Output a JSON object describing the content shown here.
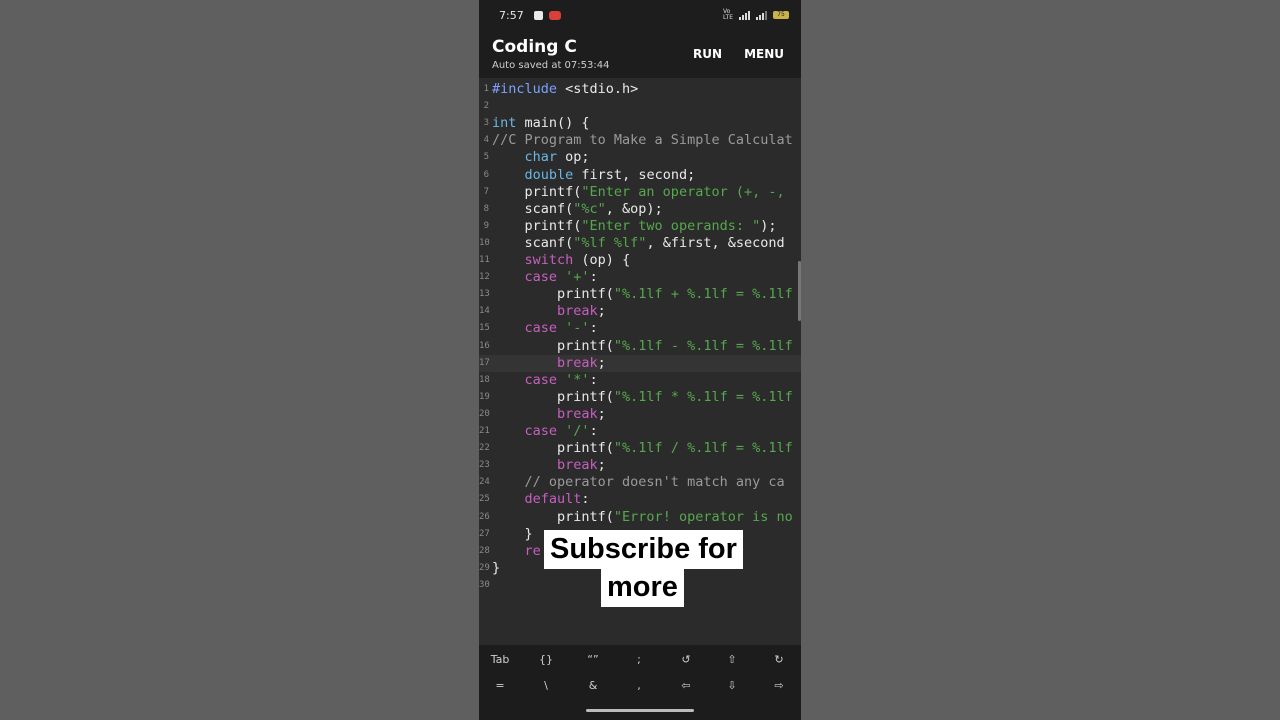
{
  "status": {
    "time": "7:57",
    "battery": "75"
  },
  "app": {
    "title": "Coding C",
    "subtitle": "Auto saved at 07:53:44",
    "run_label": "RUN",
    "menu_label": "MENU"
  },
  "code_lines": [
    {
      "n": "1",
      "tokens": [
        [
          "pre",
          "#include"
        ],
        [
          "pl",
          " <stdio.h>"
        ]
      ]
    },
    {
      "n": "2",
      "tokens": []
    },
    {
      "n": "3",
      "tokens": [
        [
          "type",
          "int"
        ],
        [
          "pl",
          " main() {"
        ]
      ]
    },
    {
      "n": "4",
      "tokens": [
        [
          "cm",
          "//C Program to Make a Simple Calculat"
        ]
      ]
    },
    {
      "n": "5",
      "tokens": [
        [
          "pl",
          "    "
        ],
        [
          "type",
          "char"
        ],
        [
          "pl",
          " op;"
        ]
      ]
    },
    {
      "n": "6",
      "tokens": [
        [
          "pl",
          "    "
        ],
        [
          "type",
          "double"
        ],
        [
          "pl",
          " first, second;"
        ]
      ]
    },
    {
      "n": "7",
      "tokens": [
        [
          "pl",
          "    printf("
        ],
        [
          "str",
          "\"Enter an operator (+, -,"
        ]
      ]
    },
    {
      "n": "8",
      "tokens": [
        [
          "pl",
          "    scanf("
        ],
        [
          "str",
          "\"%c\""
        ],
        [
          "pl",
          ", &op);"
        ]
      ]
    },
    {
      "n": "9",
      "tokens": [
        [
          "pl",
          "    printf("
        ],
        [
          "str",
          "\"Enter two operands: \""
        ],
        [
          "pl",
          ");"
        ]
      ]
    },
    {
      "n": "10",
      "tokens": [
        [
          "pl",
          "    scanf("
        ],
        [
          "str",
          "\"%lf %lf\""
        ],
        [
          "pl",
          ", &first, &second"
        ]
      ]
    },
    {
      "n": "11",
      "tokens": [
        [
          "pl",
          "    "
        ],
        [
          "kw",
          "switch"
        ],
        [
          "pl",
          " (op) {"
        ]
      ]
    },
    {
      "n": "12",
      "tokens": [
        [
          "pl",
          "    "
        ],
        [
          "kw",
          "case"
        ],
        [
          "pl",
          " "
        ],
        [
          "str",
          "'+'"
        ],
        [
          "pl",
          ":"
        ]
      ]
    },
    {
      "n": "13",
      "tokens": [
        [
          "pl",
          "        printf("
        ],
        [
          "str",
          "\"%.1lf + %.1lf = %.1lf"
        ]
      ]
    },
    {
      "n": "14",
      "tokens": [
        [
          "pl",
          "        "
        ],
        [
          "kw",
          "break"
        ],
        [
          "pl",
          ";"
        ]
      ]
    },
    {
      "n": "15",
      "tokens": [
        [
          "pl",
          "    "
        ],
        [
          "kw",
          "case"
        ],
        [
          "pl",
          " "
        ],
        [
          "str",
          "'-'"
        ],
        [
          "pl",
          ":"
        ]
      ]
    },
    {
      "n": "16",
      "tokens": [
        [
          "pl",
          "        printf("
        ],
        [
          "str",
          "\"%.1lf - %.1lf = %.1lf"
        ]
      ]
    },
    {
      "n": "17",
      "tokens": [
        [
          "pl",
          "        "
        ],
        [
          "kw",
          "break"
        ],
        [
          "pl",
          ";"
        ]
      ]
    },
    {
      "n": "18",
      "tokens": [
        [
          "pl",
          "    "
        ],
        [
          "kw",
          "case"
        ],
        [
          "pl",
          " "
        ],
        [
          "str",
          "'*'"
        ],
        [
          "pl",
          ":"
        ]
      ]
    },
    {
      "n": "19",
      "tokens": [
        [
          "pl",
          "        printf("
        ],
        [
          "str",
          "\"%.1lf * %.1lf = %.1lf"
        ]
      ]
    },
    {
      "n": "20",
      "tokens": [
        [
          "pl",
          "        "
        ],
        [
          "kw",
          "break"
        ],
        [
          "pl",
          ";"
        ]
      ]
    },
    {
      "n": "21",
      "tokens": [
        [
          "pl",
          "    "
        ],
        [
          "kw",
          "case"
        ],
        [
          "pl",
          " "
        ],
        [
          "str",
          "'/'"
        ],
        [
          "pl",
          ":"
        ]
      ]
    },
    {
      "n": "22",
      "tokens": [
        [
          "pl",
          "        printf("
        ],
        [
          "str",
          "\"%.1lf / %.1lf = %.1lf"
        ]
      ]
    },
    {
      "n": "23",
      "tokens": [
        [
          "pl",
          "        "
        ],
        [
          "kw",
          "break"
        ],
        [
          "pl",
          ";"
        ]
      ]
    },
    {
      "n": "24",
      "tokens": [
        [
          "cm",
          "    // operator doesn't match any ca"
        ]
      ]
    },
    {
      "n": "25",
      "tokens": [
        [
          "pl",
          "    "
        ],
        [
          "kw",
          "default"
        ],
        [
          "pl",
          ":"
        ]
      ]
    },
    {
      "n": "26",
      "tokens": [
        [
          "pl",
          "        printf("
        ],
        [
          "str",
          "\"Error! operator is no"
        ]
      ]
    },
    {
      "n": "27",
      "tokens": [
        [
          "pl",
          "    }"
        ]
      ]
    },
    {
      "n": "28",
      "tokens": [
        [
          "pl",
          "    "
        ],
        [
          "kw",
          "re"
        ]
      ]
    },
    {
      "n": "29",
      "tokens": [
        [
          "pl",
          "}"
        ]
      ]
    },
    {
      "n": "30",
      "tokens": []
    }
  ],
  "highlight_line": "17",
  "overlay": {
    "line1": "Subscribe for",
    "line2": "more"
  },
  "keys_row1": [
    "Tab",
    "{}",
    "“”",
    ";",
    "↺",
    "⇧",
    "↻"
  ],
  "keys_row2": [
    "=",
    "\\",
    "&",
    ",",
    "⇦",
    "⇩",
    "⇨"
  ]
}
